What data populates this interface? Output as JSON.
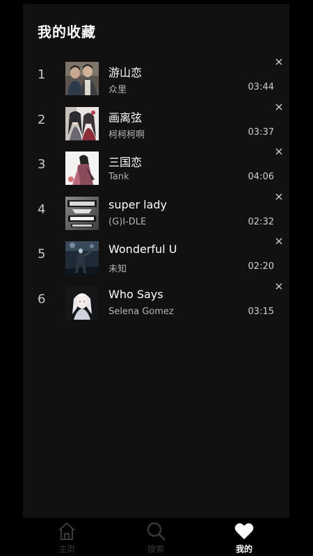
{
  "page_title": "我的收藏",
  "songs": [
    {
      "index": "1",
      "title": "游山恋",
      "artist": "众里",
      "duration": "03:44",
      "cover_icon": "two-men-portrait-cover"
    },
    {
      "index": "2",
      "title": "画离弦",
      "artist": "柯柯柯啊",
      "duration": "03:37",
      "cover_icon": "anime-characters-cover"
    },
    {
      "index": "3",
      "title": "三国恋",
      "artist": "Tank",
      "duration": "04:06",
      "cover_icon": "ink-painting-figure-cover"
    },
    {
      "index": "4",
      "title": "super lady",
      "artist": "(G)I-DLE",
      "duration": "02:32",
      "cover_icon": "album-logo-cover"
    },
    {
      "index": "5",
      "title": "Wonderful U",
      "artist": "未知",
      "duration": "02:20",
      "cover_icon": "concert-stage-cover"
    },
    {
      "index": "6",
      "title": "Who Says",
      "artist": "Selena Gomez",
      "duration": "03:15",
      "cover_icon": "anime-girl-cover"
    }
  ],
  "remove_symbol": "×",
  "tabbar": {
    "tabs": [
      {
        "label": "主页",
        "icon": "home-icon",
        "active": false
      },
      {
        "label": "搜索",
        "icon": "search-icon",
        "active": false
      },
      {
        "label": "我的",
        "icon": "heart-icon",
        "active": true
      }
    ]
  },
  "colors": {
    "background": "#000000",
    "panel": "#111111",
    "text_primary": "#ffffff",
    "text_secondary": "#b4b4b4",
    "tab_inactive": "#3a3a3a"
  }
}
